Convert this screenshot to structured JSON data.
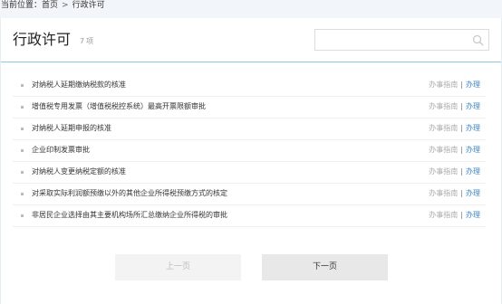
{
  "breadcrumb": {
    "prefix": "当前位置：",
    "home": "首页",
    "separator": ">",
    "current": "行政许可"
  },
  "header": {
    "title": "行政许可",
    "count_number": "7",
    "count_unit": "项"
  },
  "search": {
    "placeholder": "",
    "value": ""
  },
  "items": [
    {
      "label": "对纳税人延期缴纳税款的核准",
      "guide": "办事指南",
      "divider": "|",
      "action": "办理"
    },
    {
      "label": "增值税专用发票（增值税税控系统）最高开票限额审批",
      "guide": "办事指南",
      "divider": "|",
      "action": "办理"
    },
    {
      "label": "对纳税人延期申报的核准",
      "guide": "办事指南",
      "divider": "|",
      "action": "办理"
    },
    {
      "label": "企业印制发票审批",
      "guide": "办事指南",
      "divider": "|",
      "action": "办理"
    },
    {
      "label": "对纳税人变更纳税定额的核准",
      "guide": "办事指南",
      "divider": "|",
      "action": "办理"
    },
    {
      "label": "对采取实际利润额预缴以外的其他企业所得税预缴方式的核定",
      "guide": "办事指南",
      "divider": "|",
      "action": "办理"
    },
    {
      "label": "非居民企业选择由其主要机构场所汇总缴纳企业所得税的审批",
      "guide": "办事指南",
      "divider": "|",
      "action": "办理"
    }
  ],
  "pager": {
    "prev_label": "上一页",
    "next_label": "下一页"
  },
  "colors": {
    "accent": "#3a86c8",
    "header_border": "#8fc9e8",
    "background": "#f2f6fa"
  }
}
